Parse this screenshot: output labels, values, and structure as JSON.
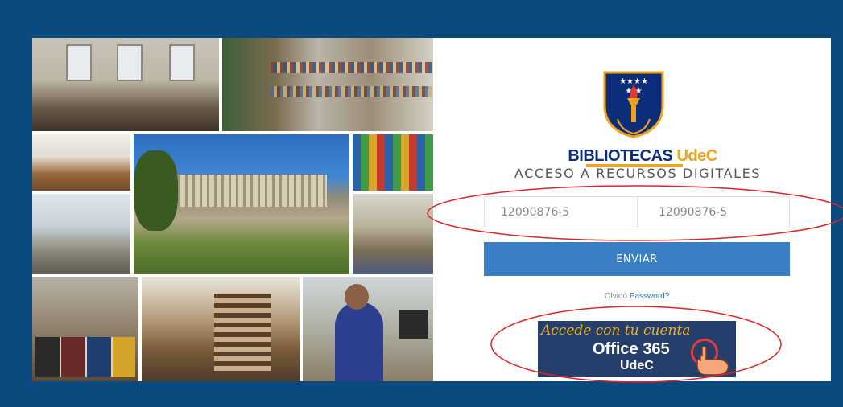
{
  "brand": {
    "name": "BIBLIOTECAS",
    "name_accent": "UdeC",
    "subtitle": "ACCESO A RECURSOS DIGITALES"
  },
  "login": {
    "username_value": "12090876-5",
    "password_value": "12090876-5",
    "submit_label": "ENVIAR",
    "forgot_prefix": "Olvidó",
    "forgot_link": "Password?"
  },
  "office_banner": {
    "line1": "Accede con tu cuenta",
    "line2": "Office 365",
    "line3": "UdeC"
  },
  "colors": {
    "page_background": "#0b4a7e",
    "button": "#3a7fc4",
    "brand_blue": "#0c2d7a",
    "brand_gold": "#f0a11d",
    "annotation_red": "#d9262b"
  },
  "icons": {
    "logo": "university-shield-icon",
    "office_pointer": "pointing-hand-icon"
  }
}
